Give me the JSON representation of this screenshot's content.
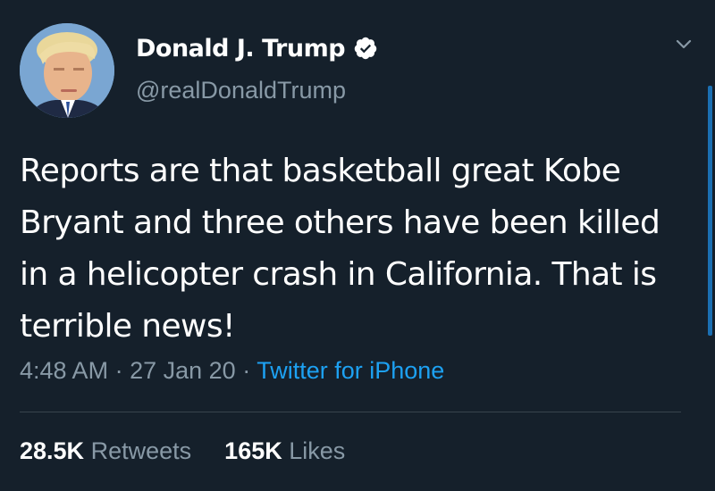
{
  "user": {
    "display_name": "Donald J. Trump",
    "handle": "@realDonaldTrump",
    "verified": true,
    "avatar_icon": "profile-photo"
  },
  "tweet": {
    "text": "Reports are that basketball great Kobe Bryant and three others have been killed in a helicopter crash in California. That is terrible news!",
    "time": "4:48 AM",
    "separator": "·",
    "date": "27 Jan 20",
    "source": "Twitter for iPhone"
  },
  "stats": {
    "retweets_count": "28.5K",
    "retweets_label": "Retweets",
    "likes_count": "165K",
    "likes_label": "Likes"
  },
  "colors": {
    "background": "#15202b",
    "primary_text": "#ffffff",
    "secondary_text": "#8899a6",
    "link": "#1da1f2",
    "divider": "#38444d"
  },
  "icons": {
    "verified": "verified-badge-icon",
    "more": "chevron-down-icon"
  }
}
